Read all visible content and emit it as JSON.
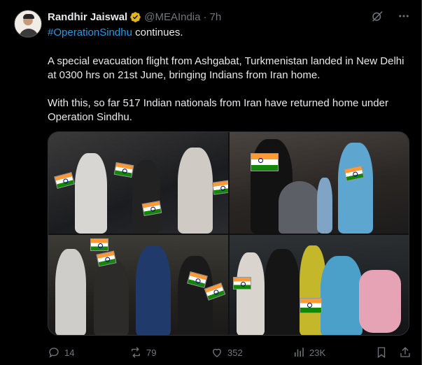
{
  "post": {
    "author_name": "Randhir Jaiswal",
    "handle": "@MEAIndia",
    "separator": "·",
    "time": "7h",
    "hashtag": "#OperationSindhu",
    "line1_rest": " continues.",
    "para2": "A special evacuation flight from Ashgabat, Turkmenistan landed in New Delhi at 0300 hrs on 21st June, bringing Indians from Iran home.",
    "para3": "With this, so far 517 Indian nationals from Iran have returned home under Operation Sindhu."
  },
  "icons": {
    "verified": "verified-badge-icon",
    "grok": "grok-icon",
    "more": "more-icon",
    "reply": "reply-icon",
    "repost": "repost-icon",
    "like": "like-icon",
    "views": "views-icon",
    "bookmark": "bookmark-icon",
    "share": "share-icon"
  },
  "actions": {
    "replies": "14",
    "reposts": "79",
    "likes": "352",
    "views": "23K"
  },
  "colors": {
    "background": "#000000",
    "text": "#e7e9ea",
    "muted": "#71767b",
    "accent": "#1d9bf0",
    "verified_gold": "#e2b719"
  }
}
